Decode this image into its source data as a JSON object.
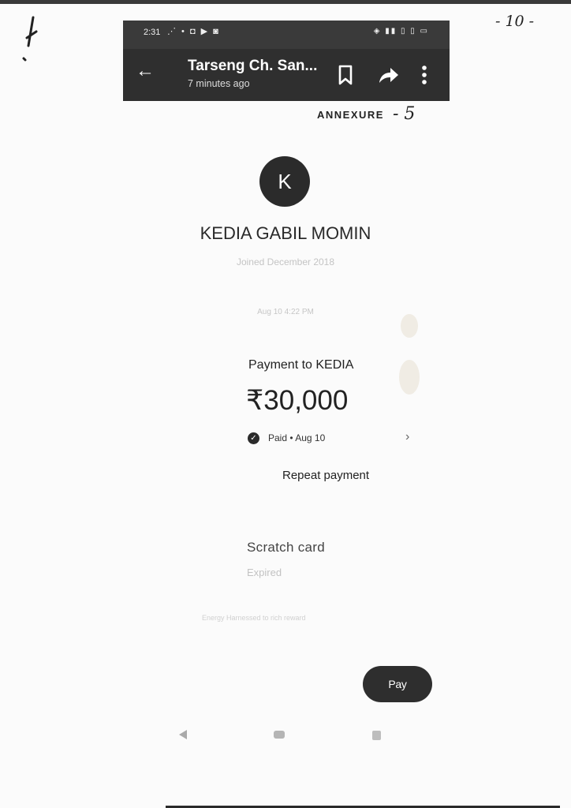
{
  "handwritten": {
    "page_number": "- 10 -",
    "annexure_number": "- 5"
  },
  "status_bar": {
    "time": "2:31",
    "left_icons": "⋰ • ◘ ▶ ◙",
    "right_icons": "◈ ▮▮ ▯ ▯ ▭"
  },
  "app_bar": {
    "back_glyph": "←",
    "title": "Tarseng Ch. San...",
    "subtitle": "7 minutes ago"
  },
  "annexure_label": "ANNEXURE",
  "contact": {
    "avatar_initial": "K",
    "name": "KEDIA GABIL MOMIN",
    "joined": "Joined December 2018"
  },
  "timestamp": "Aug 10 4:22 PM",
  "payment": {
    "title": "Payment to KEDIA",
    "amount": "₹30,000",
    "status": "Paid • Aug 10",
    "repeat_label": "Repeat payment"
  },
  "scratch_card": {
    "title": "Scratch card",
    "status": "Expired"
  },
  "energy_text": "Energy Harnessed to rich reward",
  "pay_button_label": "Pay",
  "colors": {
    "app_bar": "#2f2f2f",
    "status_bar": "#3a3a3a",
    "avatar": "#2b2b2b",
    "background": "#fbfbfb"
  }
}
